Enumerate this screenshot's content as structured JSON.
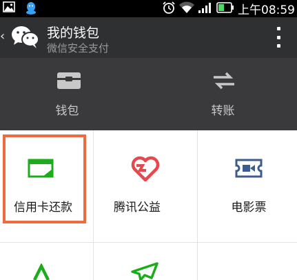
{
  "status_bar": {
    "time": "上午08:59",
    "icons": [
      "image-icon",
      "qq-icon",
      "alarm-icon",
      "wifi-icon",
      "signal-icon",
      "battery-icon"
    ]
  },
  "title_bar": {
    "title": "我的钱包",
    "subtitle": "微信安全支付",
    "back_icon": "chevron-left-icon",
    "logo": "wechat-logo-icon",
    "menu_icon": "more-vertical-icon"
  },
  "header_actions": [
    {
      "label": "钱包",
      "icon": "wallet-icon"
    },
    {
      "label": "转账",
      "icon": "transfer-icon"
    }
  ],
  "grid_items": [
    {
      "label": "信用卡还款",
      "icon": "credit-card-repay-icon",
      "highlighted": true
    },
    {
      "label": "腾讯公益",
      "icon": "charity-heart-icon"
    },
    {
      "label": "电影票",
      "icon": "movie-ticket-icon"
    },
    {
      "label": "",
      "icon": "lottery-icon"
    },
    {
      "label": "",
      "icon": "airplane-icon"
    }
  ],
  "colors": {
    "status_bar": "#000000",
    "title_bar": "#2e3032",
    "header_panel": "#3a3a3c",
    "wechat_green": "#1aad19",
    "charity_red": "#e5484d",
    "movie_blue": "#3d5b8f",
    "highlight_orange": "#ed6b3c"
  }
}
